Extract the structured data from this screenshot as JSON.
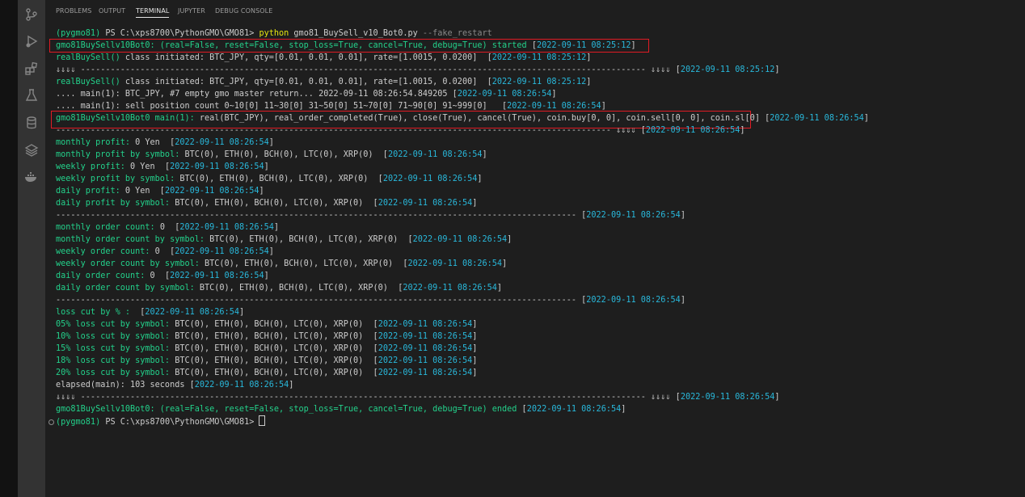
{
  "activity_bar": {
    "icons": [
      "source-control-icon",
      "run-debug-icon",
      "extensions-icon",
      "testing-icon",
      "database-icon",
      "layers-icon",
      "docker-icon"
    ]
  },
  "panel": {
    "tabs": [
      {
        "label": "PROBLEMS",
        "active": false
      },
      {
        "label": "OUTPUT",
        "active": false
      },
      {
        "label": "TERMINAL",
        "active": true
      },
      {
        "label": "JUPYTER",
        "active": false
      },
      {
        "label": "DEBUG CONSOLE",
        "active": false
      }
    ]
  },
  "terminal": {
    "colors": {
      "g": "#23d18b",
      "w": "#cccccc",
      "y": "#e5e510",
      "c": "#29b8db",
      "d": "#888888",
      "highlight_box": "#e01b24"
    },
    "lines": [
      [
        [
          "g",
          "(pygmo81) "
        ],
        [
          "w",
          "PS C:\\xps8700\\PythonGMO\\GMO81> "
        ],
        [
          "y",
          "python "
        ],
        [
          "w",
          "gmo81_BuySell_v10_Bot0.py "
        ],
        [
          "d",
          "--fake_restart"
        ]
      ],
      [
        [
          "g",
          "gmo81BuySellv10Bot0: (real=False, reset=False, stop_loss=True, cancel=True, debug=True) started "
        ],
        [
          "w",
          "["
        ],
        [
          "c",
          "2022-09-11 08:25:12"
        ],
        [
          "w",
          "]"
        ]
      ],
      [
        [
          "g",
          "realBuySell() "
        ],
        [
          "w",
          "class initiated: BTC_JPY, qty=[0.01, 0.01, 0.01], rate=[1.0015, 0.0200]  ["
        ],
        [
          "c",
          "2022-09-11 08:25:12"
        ],
        [
          "w",
          "]"
        ]
      ],
      [
        [
          "w",
          "⇓⇓⇓⇓ ------------------------------------------------------------------------------------------------------------------ ⇓⇓⇓⇓ ["
        ],
        [
          "c",
          "2022-09-11 08:25:12"
        ],
        [
          "w",
          "]"
        ]
      ],
      [
        [
          "g",
          "realBuySell() "
        ],
        [
          "w",
          "class initiated: BTC_JPY, qty=[0.01, 0.01, 0.01], rate=[1.0015, 0.0200]  ["
        ],
        [
          "c",
          "2022-09-11 08:25:12"
        ],
        [
          "w",
          "]"
        ]
      ],
      [
        [
          "w",
          ".... main(1): BTC_JPY, #7 empty gmo master return... 2022-09-11 08:26:54.849205 ["
        ],
        [
          "c",
          "2022-09-11 08:26:54"
        ],
        [
          "w",
          "]"
        ]
      ],
      [
        [
          "w",
          ".... main(1): sell position count 0~10[0] 11~30[0] 31~50[0] 51~70[0] 71~90[0] 91~999[0]   ["
        ],
        [
          "c",
          "2022-09-11 08:26:54"
        ],
        [
          "w",
          "]"
        ]
      ],
      [
        [
          "g",
          "gmo81BuySellv10Bot0 main(1): "
        ],
        [
          "w",
          "real(BTC_JPY), real_order_completed(True), close(True), cancel(True), coin.buy[0, 0], coin.sell[0, 0], coin.sl[0] ["
        ],
        [
          "c",
          "2022-09-11 08:26:54"
        ],
        [
          "w",
          "]"
        ]
      ],
      [
        [
          "w",
          "---------------------------------------------------------------------------------------------------------------- ⇓⇓⇓⇓ ["
        ],
        [
          "c",
          "2022-09-11 08:26:54"
        ],
        [
          "w",
          "]"
        ]
      ],
      [
        [
          "g",
          "monthly profit: "
        ],
        [
          "w",
          "0 Yen  ["
        ],
        [
          "c",
          "2022-09-11 08:26:54"
        ],
        [
          "w",
          "]"
        ]
      ],
      [
        [
          "g",
          "monthly profit by symbol: "
        ],
        [
          "w",
          "BTC(0), ETH(0), BCH(0), LTC(0), XRP(0)  ["
        ],
        [
          "c",
          "2022-09-11 08:26:54"
        ],
        [
          "w",
          "]"
        ]
      ],
      [
        [
          "g",
          "weekly profit: "
        ],
        [
          "w",
          "0 Yen  ["
        ],
        [
          "c",
          "2022-09-11 08:26:54"
        ],
        [
          "w",
          "]"
        ]
      ],
      [
        [
          "g",
          "weekly profit by symbol: "
        ],
        [
          "w",
          "BTC(0), ETH(0), BCH(0), LTC(0), XRP(0)  ["
        ],
        [
          "c",
          "2022-09-11 08:26:54"
        ],
        [
          "w",
          "]"
        ]
      ],
      [
        [
          "g",
          "daily profit: "
        ],
        [
          "w",
          "0 Yen  ["
        ],
        [
          "c",
          "2022-09-11 08:26:54"
        ],
        [
          "w",
          "]"
        ]
      ],
      [
        [
          "g",
          "daily profit by symbol: "
        ],
        [
          "w",
          "BTC(0), ETH(0), BCH(0), LTC(0), XRP(0)  ["
        ],
        [
          "c",
          "2022-09-11 08:26:54"
        ],
        [
          "w",
          "]"
        ]
      ],
      [
        [
          "w",
          "--------------------------------------------------------------------------------------------------------- ["
        ],
        [
          "c",
          "2022-09-11 08:26:54"
        ],
        [
          "w",
          "]"
        ]
      ],
      [
        [
          "g",
          "monthly order count: "
        ],
        [
          "w",
          "0  ["
        ],
        [
          "c",
          "2022-09-11 08:26:54"
        ],
        [
          "w",
          "]"
        ]
      ],
      [
        [
          "g",
          "monthly order count by symbol: "
        ],
        [
          "w",
          "BTC(0), ETH(0), BCH(0), LTC(0), XRP(0)  ["
        ],
        [
          "c",
          "2022-09-11 08:26:54"
        ],
        [
          "w",
          "]"
        ]
      ],
      [
        [
          "g",
          "weekly order count: "
        ],
        [
          "w",
          "0  ["
        ],
        [
          "c",
          "2022-09-11 08:26:54"
        ],
        [
          "w",
          "]"
        ]
      ],
      [
        [
          "g",
          "weekly order count by symbol: "
        ],
        [
          "w",
          "BTC(0), ETH(0), BCH(0), LTC(0), XRP(0)  ["
        ],
        [
          "c",
          "2022-09-11 08:26:54"
        ],
        [
          "w",
          "]"
        ]
      ],
      [
        [
          "g",
          "daily order count: "
        ],
        [
          "w",
          "0  ["
        ],
        [
          "c",
          "2022-09-11 08:26:54"
        ],
        [
          "w",
          "]"
        ]
      ],
      [
        [
          "g",
          "daily order count by symbol: "
        ],
        [
          "w",
          "BTC(0), ETH(0), BCH(0), LTC(0), XRP(0)  ["
        ],
        [
          "c",
          "2022-09-11 08:26:54"
        ],
        [
          "w",
          "]"
        ]
      ],
      [
        [
          "w",
          "--------------------------------------------------------------------------------------------------------- ["
        ],
        [
          "c",
          "2022-09-11 08:26:54"
        ],
        [
          "w",
          "]"
        ]
      ],
      [
        [
          "g",
          "loss cut by % : "
        ],
        [
          "w",
          " ["
        ],
        [
          "c",
          "2022-09-11 08:26:54"
        ],
        [
          "w",
          "]"
        ]
      ],
      [
        [
          "g",
          "05% loss cut by symbol: "
        ],
        [
          "w",
          "BTC(0), ETH(0), BCH(0), LTC(0), XRP(0)  ["
        ],
        [
          "c",
          "2022-09-11 08:26:54"
        ],
        [
          "w",
          "]"
        ]
      ],
      [
        [
          "g",
          "10% loss cut by symbol: "
        ],
        [
          "w",
          "BTC(0), ETH(0), BCH(0), LTC(0), XRP(0)  ["
        ],
        [
          "c",
          "2022-09-11 08:26:54"
        ],
        [
          "w",
          "]"
        ]
      ],
      [
        [
          "g",
          "15% loss cut by symbol: "
        ],
        [
          "w",
          "BTC(0), ETH(0), BCH(0), LTC(0), XRP(0)  ["
        ],
        [
          "c",
          "2022-09-11 08:26:54"
        ],
        [
          "w",
          "]"
        ]
      ],
      [
        [
          "g",
          "18% loss cut by symbol: "
        ],
        [
          "w",
          "BTC(0), ETH(0), BCH(0), LTC(0), XRP(0)  ["
        ],
        [
          "c",
          "2022-09-11 08:26:54"
        ],
        [
          "w",
          "]"
        ]
      ],
      [
        [
          "g",
          "20% loss cut by symbol: "
        ],
        [
          "w",
          "BTC(0), ETH(0), BCH(0), LTC(0), XRP(0)  ["
        ],
        [
          "c",
          "2022-09-11 08:26:54"
        ],
        [
          "w",
          "]"
        ]
      ],
      [
        [
          "w",
          "elapsed(main): 103 seconds ["
        ],
        [
          "c",
          "2022-09-11 08:26:54"
        ],
        [
          "w",
          "]"
        ]
      ],
      [
        [
          "w",
          "⇓⇓⇓⇓ ------------------------------------------------------------------------------------------------------------------ ⇓⇓⇓⇓ ["
        ],
        [
          "c",
          "2022-09-11 08:26:54"
        ],
        [
          "w",
          "]"
        ]
      ],
      [
        [
          "g",
          "gmo81BuySellv10Bot0: (real=False, reset=False, stop_loss=True, cancel=True, debug=True) ended "
        ],
        [
          "w",
          "["
        ],
        [
          "c",
          "2022-09-11 08:26:54"
        ],
        [
          "w",
          "]"
        ]
      ],
      [
        [
          "g",
          "(pygmo81) "
        ],
        [
          "w",
          "PS C:\\xps8700\\PythonGMO\\GMO81> "
        ]
      ]
    ]
  }
}
